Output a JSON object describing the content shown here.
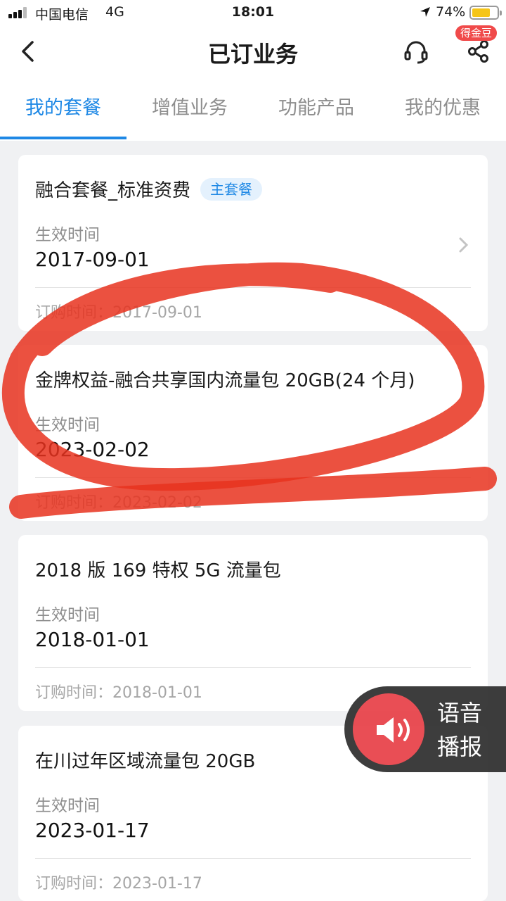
{
  "status_bar": {
    "carrier": "中国电信",
    "network": "4G",
    "time": "18:01",
    "battery": "74%",
    "battery_level": 0.74
  },
  "header": {
    "title": "已订业务",
    "badge": "得金豆",
    "back_icon": "chevron-left-icon",
    "service_icon": "headset-icon",
    "share_icon": "share-icon"
  },
  "tabs": [
    {
      "label": "我的套餐",
      "active": true
    },
    {
      "label": "增值业务",
      "active": false
    },
    {
      "label": "功能产品",
      "active": false
    },
    {
      "label": "我的优惠",
      "active": false
    }
  ],
  "packages": [
    {
      "name": "融合套餐_标准资费",
      "tag": "主套餐",
      "effective_label": "生效时间",
      "effective_date": "2017-09-01",
      "order_label": "订购时间：",
      "order_date": "2017-09-01"
    },
    {
      "name": "金牌权益-融合共享国内流量包 20GB(24 个月)",
      "effective_label": "生效时间",
      "effective_date": "2023-02-02",
      "order_label": "订购时间：",
      "order_date": "2023-02-02"
    },
    {
      "name": "2018 版 169 特权 5G 流量包",
      "effective_label": "生效时间",
      "effective_date": "2018-01-01",
      "order_label": "订购时间：",
      "order_date": "2018-01-01"
    },
    {
      "name": "在川过年区域流量包 20GB",
      "effective_label": "生效时间",
      "effective_date": "2023-01-17",
      "order_label": "订购时间：",
      "order_date": "2023-01-17"
    }
  ],
  "voice_button": {
    "line1": "语音",
    "line2": "播报",
    "icon": "speaker-icon"
  },
  "colors": {
    "accent": "#1e88e5",
    "badge": "#f04a4a",
    "annotation": "#e8321e",
    "voice_button": "#e8454c"
  }
}
